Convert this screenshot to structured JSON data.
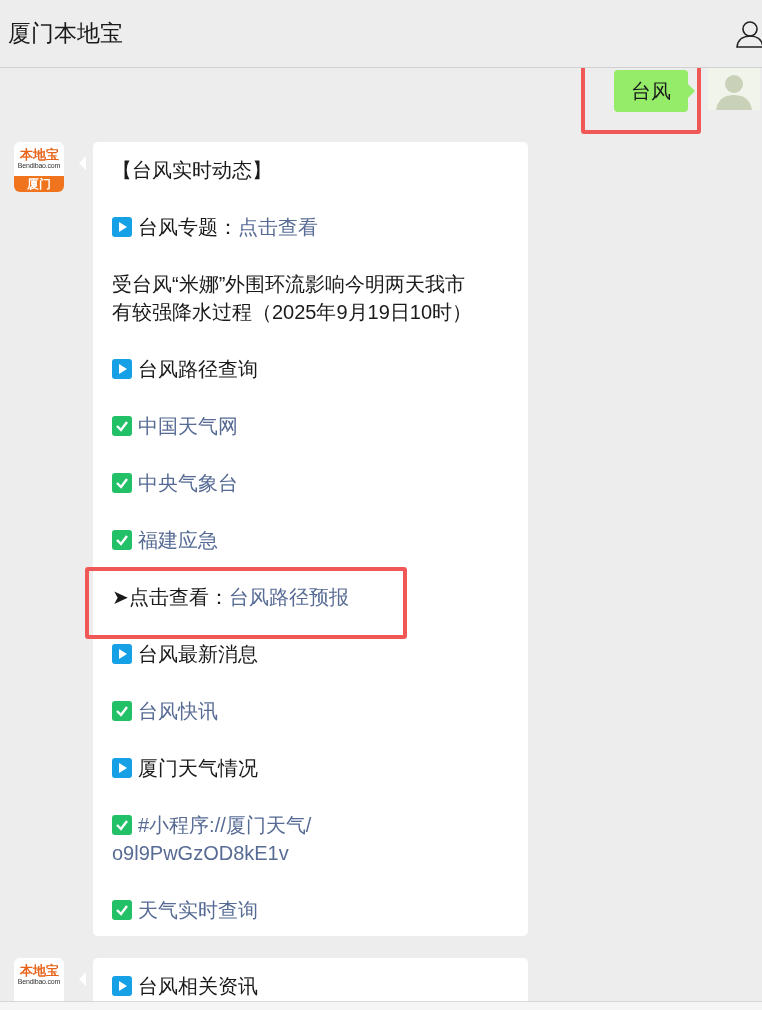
{
  "header": {
    "title": "厦门本地宝"
  },
  "messages": [
    {
      "kind": "sent",
      "text": "台风",
      "highlighted": true
    },
    {
      "kind": "received",
      "logo": {
        "name": "本地宝",
        "site": "Bendibao.com",
        "city": "厦门"
      },
      "lines": [
        {
          "kind": "heading",
          "text": "【台风实时动态】",
          "highlighted": false
        },
        {
          "kind": "play",
          "text": "台风专题：",
          "link": "点击查看",
          "highlighted": false
        },
        {
          "kind": "paragraph",
          "text": "受台风“米娜”外围环流影响今明两天我市有较强降水过程（2025年9月19日10时）",
          "highlighted": false
        },
        {
          "kind": "play",
          "text": "台风路径查询",
          "highlighted": false
        },
        {
          "kind": "check",
          "link": "中国天气网",
          "highlighted": false
        },
        {
          "kind": "check",
          "link": "中央气象台",
          "highlighted": false
        },
        {
          "kind": "check",
          "link": "福建应急",
          "highlighted": false
        },
        {
          "kind": "arrow",
          "marker": "➤",
          "text": "点击查看：",
          "link": "台风路径预报",
          "highlighted": true
        },
        {
          "kind": "play",
          "text": "台风最新消息",
          "highlighted": false
        },
        {
          "kind": "check",
          "link": "台风快讯",
          "highlighted": false
        },
        {
          "kind": "play",
          "text": "厦门天气情况",
          "highlighted": false
        },
        {
          "kind": "check",
          "link_lines": [
            "#小程序://厦门天气/",
            "o9l9PwGzOD8kE1v"
          ],
          "highlighted": false
        },
        {
          "kind": "check",
          "link": "天气实时查询",
          "highlighted": false
        }
      ]
    },
    {
      "kind": "received",
      "logo": {
        "name": "本地宝",
        "site": "Bendibao.com"
      },
      "lines": [
        {
          "kind": "play",
          "text": "台风相关资讯",
          "highlighted": false
        }
      ]
    }
  ]
}
